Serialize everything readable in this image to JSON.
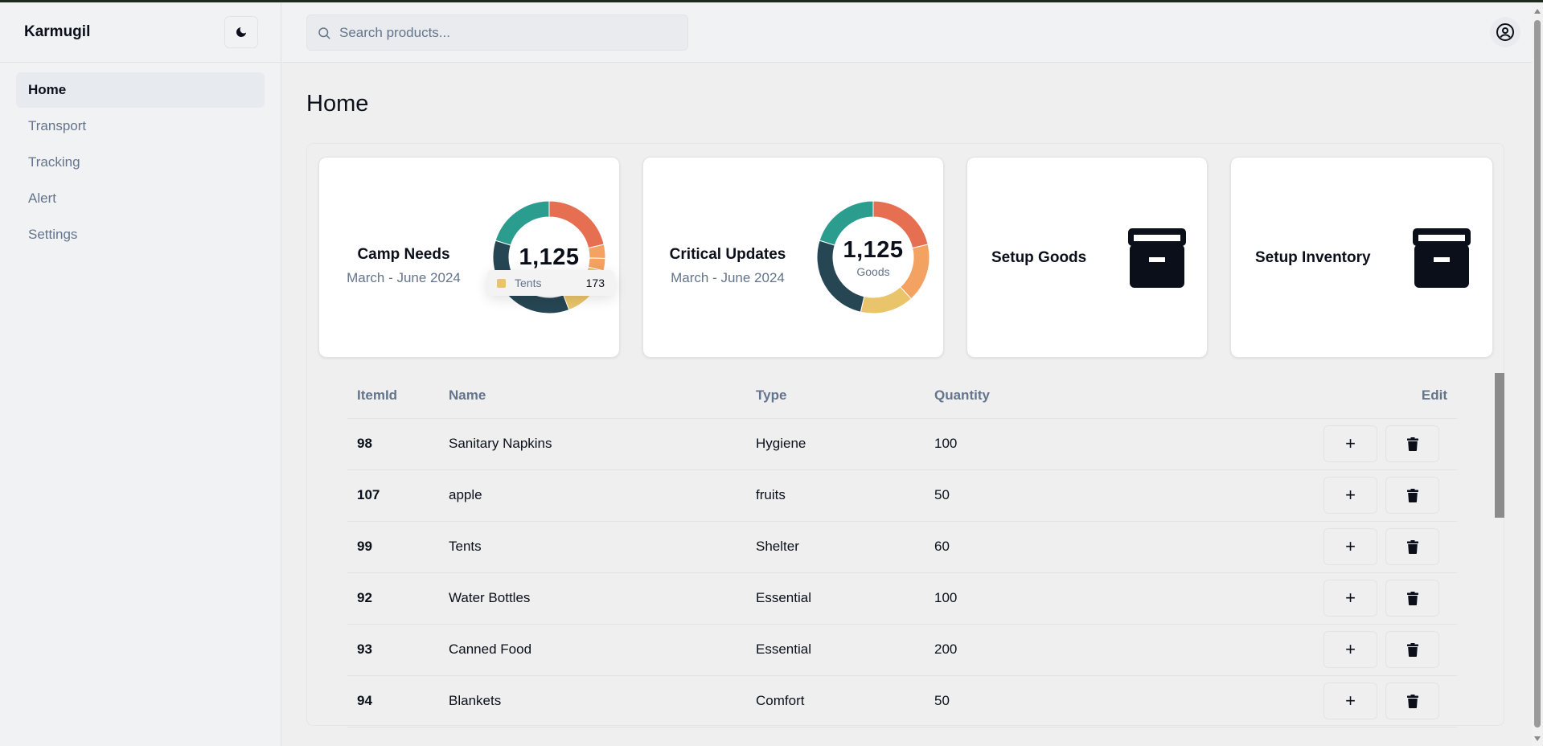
{
  "app": {
    "brand": "Karmugil"
  },
  "header": {
    "search_placeholder": "Search products...",
    "theme_toggle_icon": "moon-icon",
    "user_icon": "user-circle-icon"
  },
  "sidebar": {
    "items": [
      {
        "label": "Home",
        "active": true
      },
      {
        "label": "Transport",
        "active": false
      },
      {
        "label": "Tracking",
        "active": false
      },
      {
        "label": "Alert",
        "active": false
      },
      {
        "label": "Settings",
        "active": false
      }
    ]
  },
  "main": {
    "title": "Home",
    "cards": [
      {
        "title": "Camp Needs",
        "subtitle": "March - June 2024",
        "total": "1,125",
        "center_label": "",
        "tooltip": {
          "label": "Tents",
          "value": "173"
        }
      },
      {
        "title": "Critical Updates",
        "subtitle": "March - June 2024",
        "total": "1,125",
        "center_label": "Goods"
      },
      {
        "title": "Setup Goods",
        "icon": "archive-box-icon"
      },
      {
        "title": "Setup Inventory",
        "icon": "archive-box-icon"
      }
    ],
    "table": {
      "headers": [
        "ItemId",
        "Name",
        "Type",
        "Quantity",
        "Edit"
      ],
      "rows": [
        {
          "id": "98",
          "name": "Sanitary Napkins",
          "type": "Hygiene",
          "quantity": "100"
        },
        {
          "id": "107",
          "name": "apple",
          "type": "fruits",
          "quantity": "50"
        },
        {
          "id": "99",
          "name": "Tents",
          "type": "Shelter",
          "quantity": "60"
        },
        {
          "id": "92",
          "name": "Water Bottles",
          "type": "Essential",
          "quantity": "100"
        },
        {
          "id": "93",
          "name": "Canned Food",
          "type": "Essential",
          "quantity": "200"
        },
        {
          "id": "94",
          "name": "Blankets",
          "type": "Comfort",
          "quantity": "50"
        }
      ],
      "add_label": "+",
      "delete_icon": "trash-icon"
    }
  },
  "chart_data": [
    {
      "type": "pie",
      "title": "Camp Needs",
      "total": 1125,
      "segments": [
        {
          "value": 240,
          "color": "#e76f51"
        },
        {
          "value": 45,
          "color": "#f4a261"
        },
        {
          "value": 40,
          "color": "#f4a261"
        },
        {
          "value": 173,
          "color": "#e9c46a",
          "label": "Tents"
        },
        {
          "value": 400,
          "color": "#264653"
        },
        {
          "value": 227,
          "color": "#2a9d8f"
        }
      ]
    },
    {
      "type": "pie",
      "title": "Critical Updates",
      "total": 1125,
      "segments": [
        {
          "value": 240,
          "color": "#e76f51"
        },
        {
          "value": 190,
          "color": "#f4a261"
        },
        {
          "value": 173,
          "color": "#e9c46a"
        },
        {
          "value": 295,
          "color": "#264653"
        },
        {
          "value": 227,
          "color": "#2a9d8f"
        }
      ]
    }
  ]
}
